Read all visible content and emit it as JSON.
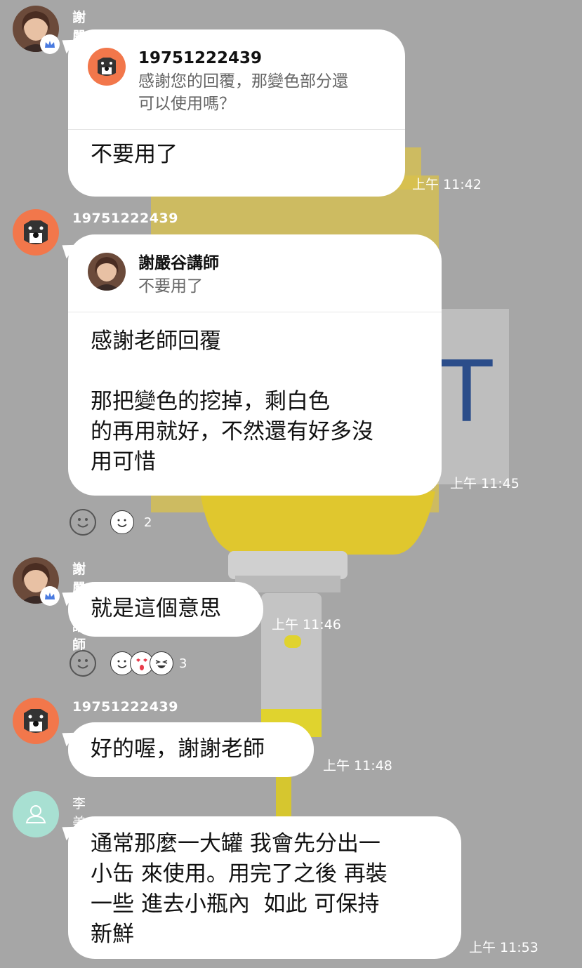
{
  "messages": [
    {
      "sender": "謝嚴谷講師",
      "quote": {
        "name": "19751222439",
        "body": "感謝您的回覆，那變色部分還\n可以使用嗎？"
      },
      "text": "不要用了",
      "time": "上午 11:42"
    },
    {
      "sender": "19751222439",
      "quote": {
        "name": "謝嚴谷講師",
        "body": "不要用了"
      },
      "text": "感謝老師回覆\n\n那把變色的挖掉，剩白色\n的再用就好，不然還有好多沒\n用可惜",
      "time": "上午 11:45",
      "reaction_count": "2"
    },
    {
      "sender": "謝嚴谷講師",
      "text": "就是這個意思",
      "time": "上午 11:46",
      "reaction_count": "3"
    },
    {
      "sender": "19751222439",
      "text": "好的喔，謝謝老師",
      "time": "上午 11:48"
    },
    {
      "sender": "李美鳳",
      "text": "通常那麼一大罐 我會先分出一\n小缶 來使用。用完了之後 再裝\n一些 進去小瓶內  如此 可保持\n新鮮",
      "time": "上午 11:53"
    }
  ],
  "colors": {
    "background": "#a6a6a6",
    "bubble": "#ffffff",
    "dog_avatar_bg": "#f2774b",
    "default_avatar_bg": "#a8e0d2",
    "crown": "#4a7be0"
  }
}
